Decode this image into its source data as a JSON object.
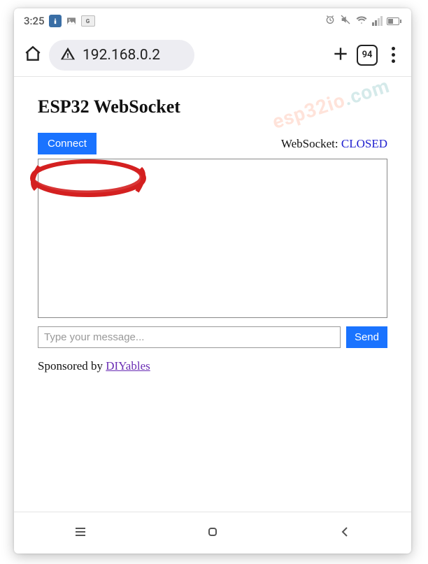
{
  "status": {
    "time": "3:25",
    "google_badge": "G",
    "tab_count": "94"
  },
  "browser": {
    "url": "192.168.0.2"
  },
  "page": {
    "title": "ESP32 WebSocket",
    "connect_label": "Connect",
    "ws_label": "WebSocket: ",
    "ws_state": "CLOSED",
    "input_placeholder": "Type your message...",
    "send_label": "Send",
    "sponsor_prefix": "Sponsored by ",
    "sponsor_link": "DIYables"
  },
  "watermark": {
    "part1": "esp32io",
    "part2": ".com"
  }
}
